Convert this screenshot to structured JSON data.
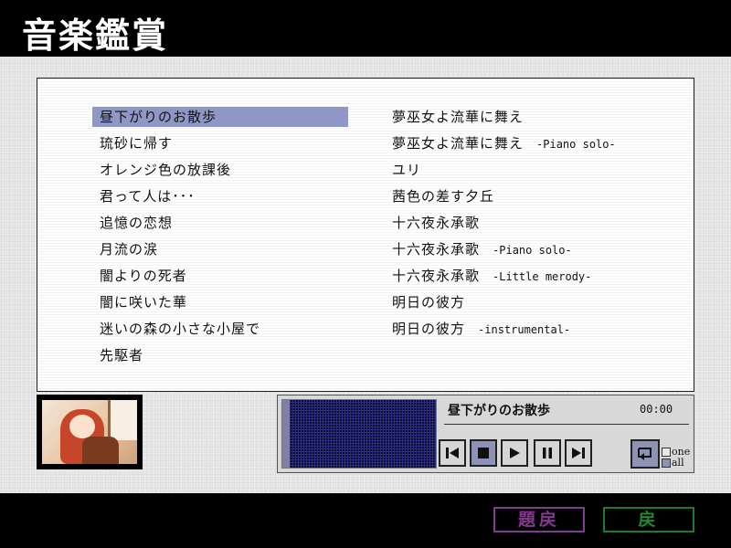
{
  "app": {
    "title": "音楽鑑賞"
  },
  "tracks_left": [
    {
      "label": "昼下がりのお散歩",
      "selected": true
    },
    {
      "label": "琉砂に帰す"
    },
    {
      "label": "オレンジ色の放課後"
    },
    {
      "label": "君って人は･･･"
    },
    {
      "label": "追憶の恋想"
    },
    {
      "label": "月流の涙"
    },
    {
      "label": "闇よりの死者"
    },
    {
      "label": "闇に咲いた華"
    },
    {
      "label": "迷いの森の小さな小屋で"
    },
    {
      "label": "先駆者"
    }
  ],
  "tracks_right": [
    {
      "label": "夢巫女よ流華に舞え",
      "sub": ""
    },
    {
      "label": "夢巫女よ流華に舞え",
      "sub": "-Piano solo-"
    },
    {
      "label": "ユリ",
      "sub": ""
    },
    {
      "label": "茜色の差す夕丘",
      "sub": ""
    },
    {
      "label": "十六夜永承歌",
      "sub": ""
    },
    {
      "label": "十六夜永承歌",
      "sub": "-Piano solo-"
    },
    {
      "label": "十六夜永承歌",
      "sub": "-Little merody-"
    },
    {
      "label": "明日の彼方",
      "sub": ""
    },
    {
      "label": "明日の彼方",
      "sub": "-instrumental-"
    }
  ],
  "player": {
    "now_playing": "昼下がりのお散歩",
    "time": "00:00",
    "controls": [
      "previous-icon",
      "stop-icon",
      "play-icon",
      "pause-icon",
      "next-icon"
    ],
    "active_control": "stop-icon",
    "repeat_options": {
      "one": "one",
      "all": "all",
      "selected": "all"
    }
  },
  "footer": {
    "title_button": "題戻",
    "back_button": "戻"
  },
  "colors": {
    "selection": "#8f97c6",
    "button_active": "#8e92b4",
    "title_btn": "#86378f",
    "back_btn": "#1f8a30"
  }
}
